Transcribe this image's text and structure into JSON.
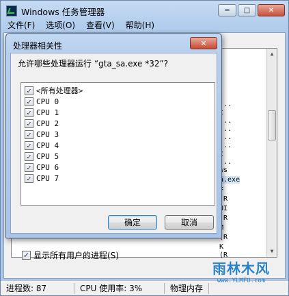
{
  "main": {
    "title": "Windows 任务管理器",
    "menu": [
      "文件(F)",
      "选项(O)",
      "查看(V)",
      "帮助(H)"
    ],
    "list_fragments": [
      {
        "text": "..."
      },
      {
        "text": "t"
      },
      {
        "text": "..."
      },
      {
        "text": "..."
      },
      {
        "text": "..."
      },
      {
        "text": "..."
      },
      {
        "text": "t"
      },
      {
        "text": "..."
      },
      {
        "text": "ws"
      },
      {
        "text": "a.exe"
      },
      {
        "text": "<"
      },
      {
        "text": "(R"
      },
      {
        "text": "UI"
      },
      {
        "text": "(R"
      },
      {
        "text": "M"
      },
      {
        "text": "(R"
      },
      {
        "text": "K"
      },
      {
        "text": "(R"
      },
      {
        "text": "(R"
      },
      {
        "text": "M"
      }
    ],
    "show_all_label": "显示所有用户的进程(S)",
    "show_all_checked": true,
    "status": {
      "processes": "进程数: 87",
      "cpu": "CPU 使用率: 3%",
      "memory": "物理内存"
    }
  },
  "dialog": {
    "title": "处理器相关性",
    "prompt": "允许哪些处理器运行 “gta_sa.exe *32”?",
    "items": [
      {
        "label": "<所有处理器>",
        "checked": true
      },
      {
        "label": "CPU 0",
        "checked": true
      },
      {
        "label": "CPU 1",
        "checked": true
      },
      {
        "label": "CPU 2",
        "checked": true
      },
      {
        "label": "CPU 3",
        "checked": true
      },
      {
        "label": "CPU 4",
        "checked": true
      },
      {
        "label": "CPU 5",
        "checked": true
      },
      {
        "label": "CPU 6",
        "checked": true
      },
      {
        "label": "CPU 7",
        "checked": true
      }
    ],
    "ok_label": "确定",
    "cancel_label": "取消"
  },
  "watermark": {
    "name": "雨林木风",
    "url": "www.YLMFU.com"
  },
  "icons": {
    "check": "checkmark-icon",
    "close": "close-icon",
    "minimize": "minimize-icon",
    "maximize": "maximize-icon"
  }
}
